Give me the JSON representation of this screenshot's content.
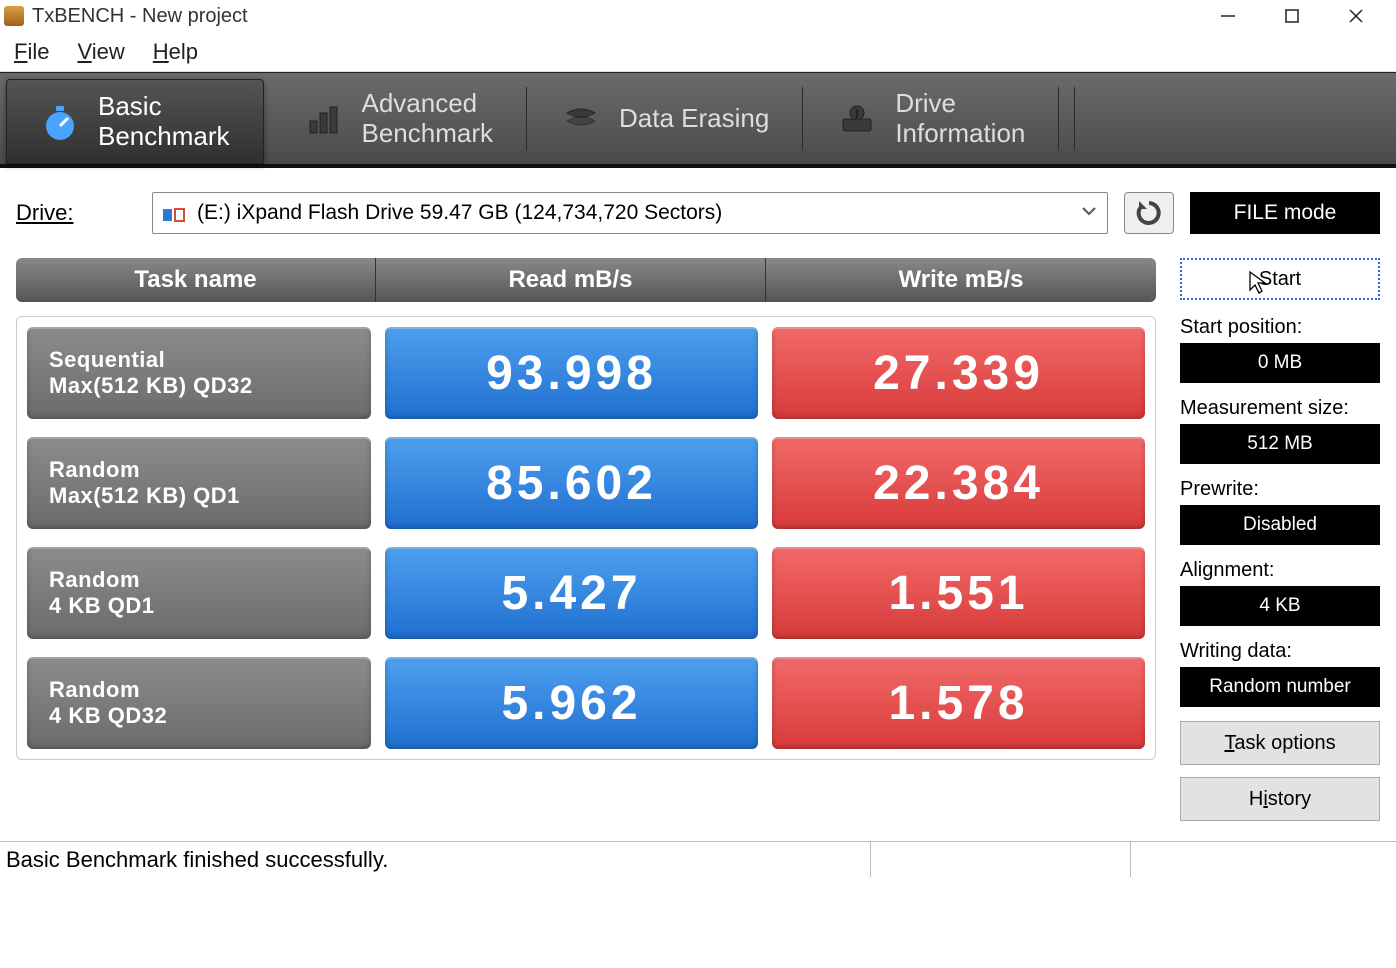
{
  "window": {
    "title": "TxBENCH - New project"
  },
  "menu": {
    "file": "File",
    "view": "View",
    "help": "Help"
  },
  "tabs": {
    "basic": "Basic\nBenchmark",
    "advanced": "Advanced\nBenchmark",
    "erasing": "Data Erasing",
    "driveinfo": "Drive\nInformation"
  },
  "drive": {
    "label": "Drive:",
    "value": "(E:) iXpand Flash Drive  59.47 GB (124,734,720 Sectors)",
    "mode": "FILE mode"
  },
  "columns": {
    "task": "Task name",
    "read": "Read mB/s",
    "write": "Write mB/s"
  },
  "rows": [
    {
      "l1": "Sequential",
      "l2": "Max(512 KB) QD32",
      "read": "93.998",
      "write": "27.339"
    },
    {
      "l1": "Random",
      "l2": "Max(512 KB) QD1",
      "read": "85.602",
      "write": "22.384"
    },
    {
      "l1": "Random",
      "l2": "4 KB QD1",
      "read": "5.427",
      "write": "1.551"
    },
    {
      "l1": "Random",
      "l2": "4 KB QD32",
      "read": "5.962",
      "write": "1.578"
    }
  ],
  "sidebar": {
    "start": "Start",
    "start_position_label": "Start position:",
    "start_position_value": "0 MB",
    "measurement_label": "Measurement size:",
    "measurement_value": "512 MB",
    "prewrite_label": "Prewrite:",
    "prewrite_value": "Disabled",
    "alignment_label": "Alignment:",
    "alignment_value": "4 KB",
    "writing_label": "Writing data:",
    "writing_value": "Random number",
    "task_options": "Task options",
    "history": "History"
  },
  "status": "Basic Benchmark finished successfully."
}
